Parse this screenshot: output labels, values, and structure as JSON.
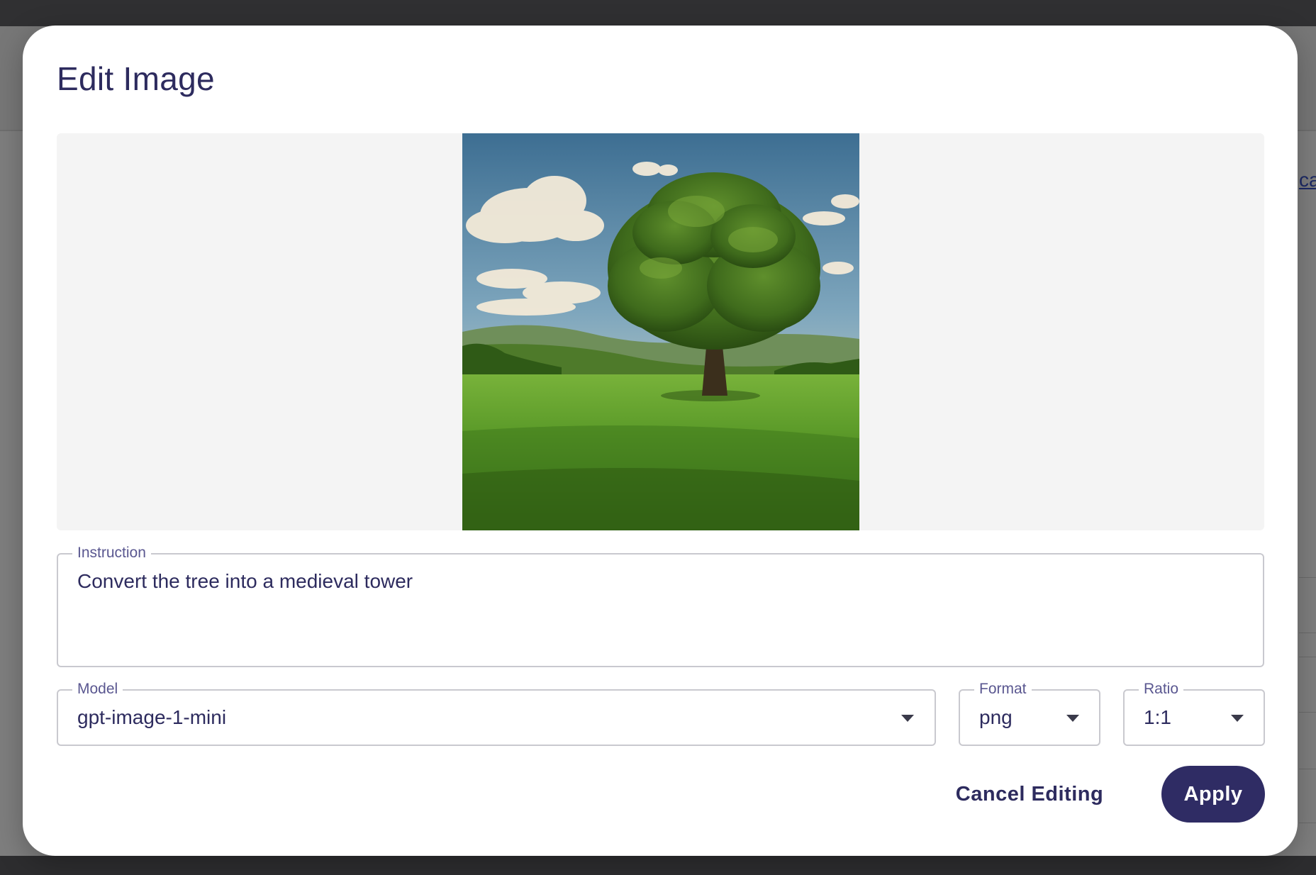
{
  "background": {
    "link_fragment": "ca"
  },
  "dialog": {
    "title": "Edit Image",
    "preview": {
      "image_subject": "lone green tree in a grassy meadow under a blue sky with clouds"
    },
    "instruction": {
      "label": "Instruction",
      "value": "Convert the tree into a medieval tower"
    },
    "model": {
      "label": "Model",
      "value": "gpt-image-1-mini"
    },
    "format": {
      "label": "Format",
      "value": "png"
    },
    "ratio": {
      "label": "Ratio",
      "value": "1:1"
    },
    "actions": {
      "cancel_label": "Cancel Editing",
      "apply_label": "Apply"
    }
  },
  "colors": {
    "primary": "#2f2c64",
    "text": "#2d2b5e",
    "label": "#5a5790",
    "preview_bg": "#f4f4f4",
    "overlay": "#7e7e7e"
  }
}
